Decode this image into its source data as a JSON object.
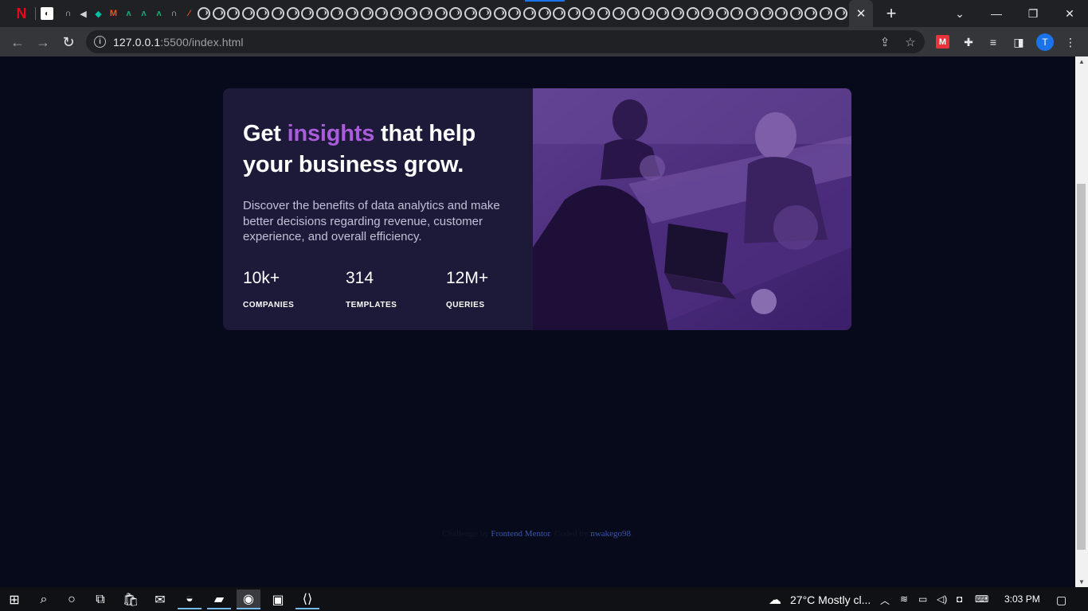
{
  "browser": {
    "active_tab_close": "✕",
    "new_tab": "+",
    "url_host": "127.0.0.1",
    "url_rest": ":5500/index.html",
    "profile_initial": "T"
  },
  "page": {
    "headline_pre": "Get ",
    "headline_accent": "insights",
    "headline_post": " that help your business grow.",
    "description": "Discover the benefits of data analytics and make better decisions regarding revenue, customer experience, and overall efficiency.",
    "stats": [
      {
        "value": "10k+",
        "label": "COMPANIES"
      },
      {
        "value": "314",
        "label": "TEMPLATES"
      },
      {
        "value": "12M+",
        "label": "QUERIES"
      }
    ],
    "footer": {
      "challenge_text": "Challenge by ",
      "challenge_link": "Frontend Mentor",
      "coded_text": ". Coded by ",
      "coded_link": "nwakego98",
      "end": "."
    }
  },
  "taskbar": {
    "weather": "27°C  Mostly cl...",
    "time": "3:03 PM"
  },
  "colors": {
    "page_bg": "#070a1a",
    "card_bg": "#1c1a38",
    "accent": "#aa5cdb",
    "image_overlay": "#4a2a7a"
  }
}
